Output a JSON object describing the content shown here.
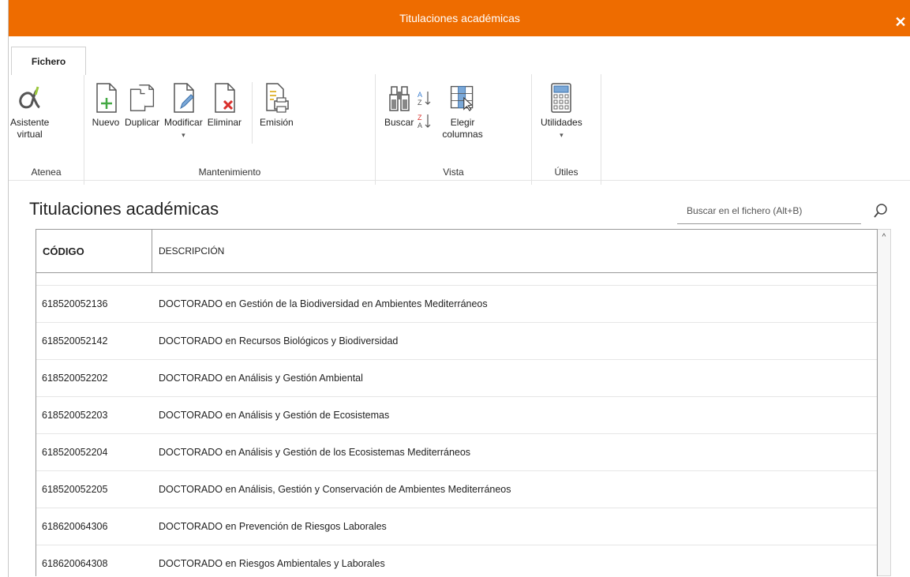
{
  "window": {
    "title": "Titulaciones académicas",
    "close_glyph": "✕",
    "accent_color": "#ee6c00"
  },
  "ribbon": {
    "tab": "Fichero",
    "groups": {
      "atenea": {
        "label": "Atenea",
        "asistente": {
          "line1": "Asistente",
          "line2": "virtual",
          "icon": "alpha-assistant-icon"
        }
      },
      "mantenimiento": {
        "label": "Mantenimiento",
        "nuevo": {
          "label": "Nuevo",
          "icon": "new-document-icon"
        },
        "duplicar": {
          "label": "Duplicar",
          "icon": "duplicate-document-icon"
        },
        "modificar": {
          "label": "Modificar",
          "icon": "edit-document-icon"
        },
        "eliminar": {
          "label": "Eliminar",
          "icon": "delete-document-icon"
        },
        "emision": {
          "label": "Emisión",
          "icon": "print-document-icon"
        }
      },
      "vista": {
        "label": "Vista",
        "buscar": {
          "label": "Buscar",
          "icon": "binoculars-icon"
        },
        "sort_asc_icon": "sort-ascending-icon",
        "sort_desc_icon": "sort-descending-icon",
        "elegir": {
          "line1": "Elegir",
          "line2": "columnas",
          "icon": "choose-columns-icon"
        }
      },
      "utiles": {
        "label": "Útiles",
        "utilidades": {
          "label": "Utilidades",
          "icon": "calculator-icon"
        }
      }
    }
  },
  "main": {
    "title": "Titulaciones académicas",
    "search": {
      "placeholder": "Buscar en el fichero (Alt+B)",
      "icon": "search-icon"
    },
    "table": {
      "columns": [
        "CÓDIGO",
        "DESCRIPCIÓN"
      ],
      "rows": [
        {
          "code": "618520052136",
          "desc": "DOCTORADO en Gestión de la Biodiversidad en Ambientes Mediterráneos"
        },
        {
          "code": "618520052142",
          "desc": "DOCTORADO en Recursos Biológicos y Biodiversidad"
        },
        {
          "code": "618520052202",
          "desc": "DOCTORADO en Análisis y Gestión Ambiental"
        },
        {
          "code": "618520052203",
          "desc": "DOCTORADO en Análisis y Gestión de Ecosistemas"
        },
        {
          "code": "618520052204",
          "desc": "DOCTORADO en Análisis y Gestión de los Ecosistemas Mediterráneos"
        },
        {
          "code": "618520052205",
          "desc": "DOCTORADO en Análisis, Gestión y Conservación de Ambientes Mediterráneos"
        },
        {
          "code": "618620064306",
          "desc": "DOCTORADO en Prevención de Riesgos Laborales"
        },
        {
          "code": "618620064308",
          "desc": "DOCTORADO en Riesgos Ambientales y Laborales"
        }
      ]
    },
    "scroll_up_glyph": "^"
  }
}
